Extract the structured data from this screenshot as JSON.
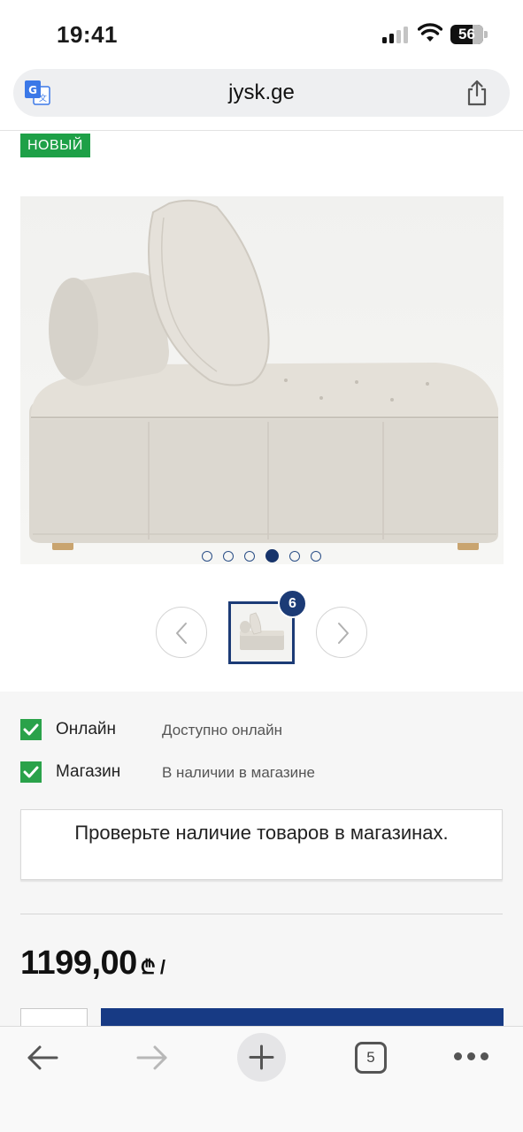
{
  "status_bar": {
    "time": "19:41",
    "battery_level": "56",
    "icons": [
      "cellular-signal-icon",
      "wifi-icon",
      "battery-icon"
    ]
  },
  "browser": {
    "url": "jysk.ge",
    "icons": [
      "translate-icon",
      "share-icon"
    ]
  },
  "product": {
    "badge": "НОВЫЙ",
    "image_index": 4,
    "image_count": 6,
    "thumbnail_count": "6",
    "price": "1199,00",
    "price_unit": "₾ /"
  },
  "availability": {
    "online_label": "Онлайн",
    "online_status": "Доступно онлайн",
    "store_label": "Магазин",
    "store_status": "В наличии в магазине",
    "check_stores_label": "Проверьте наличие товаров в магазинах."
  },
  "toolbar": {
    "tabs_count": "5",
    "icons": [
      "back-arrow-icon",
      "forward-arrow-icon",
      "plus-icon",
      "tabs-icon",
      "more-icon"
    ]
  },
  "colors": {
    "brand_blue": "#173a84",
    "badge_green": "#1ea047",
    "check_green": "#2aa24a"
  }
}
